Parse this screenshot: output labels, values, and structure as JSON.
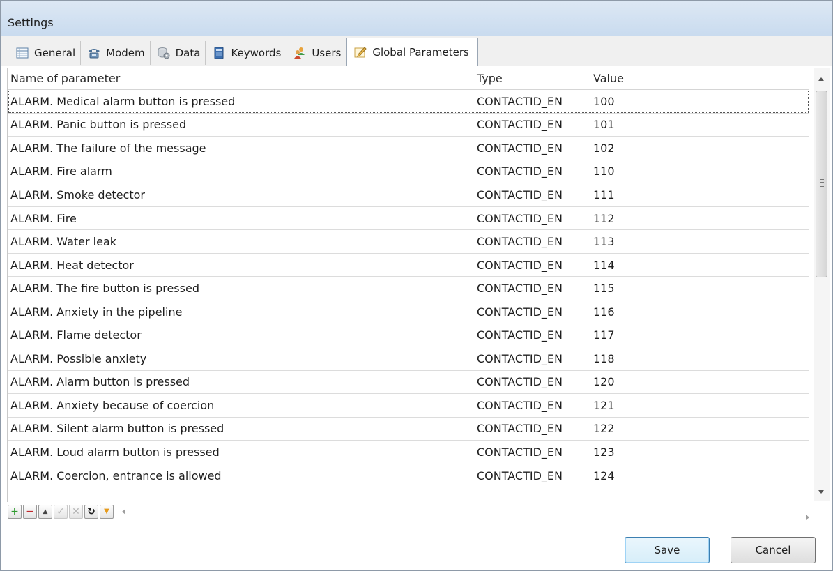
{
  "window": {
    "title": "Settings"
  },
  "tabs": [
    {
      "label": "General",
      "icon": "grid-list-icon"
    },
    {
      "label": "Modem",
      "icon": "telephone-icon"
    },
    {
      "label": "Data",
      "icon": "gear-db-icon"
    },
    {
      "label": "Keywords",
      "icon": "book-icon"
    },
    {
      "label": "Users",
      "icon": "users-icon"
    },
    {
      "label": "Global Parameters",
      "icon": "edit-note-icon",
      "active": true
    }
  ],
  "grid": {
    "columns": {
      "name": "Name of parameter",
      "type": "Type",
      "value": "Value"
    },
    "rows": [
      {
        "name": "ALARM. Medical alarm button is pressed",
        "type": "CONTACTID_EN",
        "value": "100"
      },
      {
        "name": "ALARM. Panic button is pressed",
        "type": "CONTACTID_EN",
        "value": "101"
      },
      {
        "name": "ALARM. The failure of the message",
        "type": "CONTACTID_EN",
        "value": "102"
      },
      {
        "name": "ALARM. Fire alarm",
        "type": "CONTACTID_EN",
        "value": "110"
      },
      {
        "name": "ALARM. Smoke detector",
        "type": "CONTACTID_EN",
        "value": "111"
      },
      {
        "name": "ALARM. Fire",
        "type": "CONTACTID_EN",
        "value": "112"
      },
      {
        "name": "ALARM. Water leak",
        "type": "CONTACTID_EN",
        "value": "113"
      },
      {
        "name": "ALARM. Heat detector",
        "type": "CONTACTID_EN",
        "value": "114"
      },
      {
        "name": "ALARM. The fire button is pressed",
        "type": "CONTACTID_EN",
        "value": "115"
      },
      {
        "name": "ALARM. Anxiety in the pipeline",
        "type": "CONTACTID_EN",
        "value": "116"
      },
      {
        "name": "ALARM. Flame detector",
        "type": "CONTACTID_EN",
        "value": "117"
      },
      {
        "name": "ALARM. Possible anxiety",
        "type": "CONTACTID_EN",
        "value": "118"
      },
      {
        "name": "ALARM. Alarm button is pressed",
        "type": "CONTACTID_EN",
        "value": "120"
      },
      {
        "name": "ALARM. Anxiety because of coercion",
        "type": "CONTACTID_EN",
        "value": "121"
      },
      {
        "name": "ALARM. Silent alarm button is pressed",
        "type": "CONTACTID_EN",
        "value": "122"
      },
      {
        "name": "ALARM. Loud alarm button is pressed",
        "type": "CONTACTID_EN",
        "value": "123"
      },
      {
        "name": "ALARM. Coercion, entrance is allowed",
        "type": "CONTACTID_EN",
        "value": "124"
      }
    ]
  },
  "toolbar": {
    "buttons": [
      {
        "icon": "add-icon",
        "glyph": "+"
      },
      {
        "icon": "remove-icon",
        "glyph": "−"
      },
      {
        "icon": "move-up-icon",
        "glyph": "▲"
      },
      {
        "icon": "apply-icon",
        "glyph": "✓"
      },
      {
        "icon": "cancel-edit-icon",
        "glyph": "✕"
      },
      {
        "icon": "refresh-icon",
        "glyph": "↻"
      },
      {
        "icon": "filter-icon",
        "glyph": "▼"
      }
    ]
  },
  "buttons": {
    "save": "Save",
    "cancel": "Cancel"
  },
  "colors": {
    "add": "#2e9a2e",
    "remove": "#c0282d",
    "filter": "#e69a1a",
    "default_button_border": "#3c7fb1"
  }
}
